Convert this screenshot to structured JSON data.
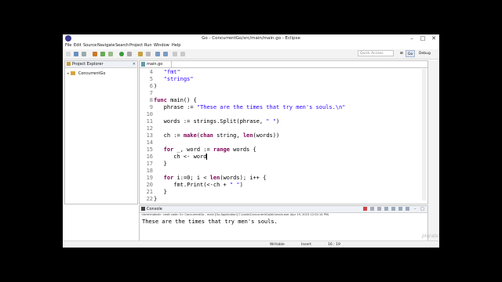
{
  "window": {
    "title": "Go - ConcurrentGo/src/main/main.go - Eclipse"
  },
  "menu": [
    "File",
    "Edit",
    "Source",
    "Navigate",
    "Search",
    "Project",
    "Run",
    "Window",
    "Help"
  ],
  "toolbar": {
    "quick_access_placeholder": "Quick Access",
    "perspectives": [
      "Go",
      "Debug"
    ]
  },
  "project_explorer": {
    "tab_label": "Project Explorer",
    "project": "ConcurrentGo"
  },
  "editor": {
    "tab_label": "main.go",
    "lines": [
      {
        "num": "4",
        "text": "\t\"fmt\""
      },
      {
        "num": "5",
        "text": "\t\"strings\""
      },
      {
        "num": "6",
        "text": ")"
      },
      {
        "num": "7",
        "text": ""
      },
      {
        "num": "8",
        "text": "func main() {"
      },
      {
        "num": "9",
        "text": "\tphrase := \"These are the times that try men's souls.\\n\""
      },
      {
        "num": "10",
        "text": ""
      },
      {
        "num": "11",
        "text": "\twords := strings.Split(phrase, \" \")"
      },
      {
        "num": "12",
        "text": ""
      },
      {
        "num": "13",
        "text": "\tch := make(chan string, len(words))"
      },
      {
        "num": "14",
        "text": ""
      },
      {
        "num": "15",
        "text": "\tfor _, word := range words {"
      },
      {
        "num": "16",
        "text": "\t\tch <- word"
      },
      {
        "num": "17",
        "text": "\t}"
      },
      {
        "num": "18",
        "text": ""
      },
      {
        "num": "19",
        "text": "\tfor i:=0; i < len(words); i++ {"
      },
      {
        "num": "20",
        "text": "\t\tfmt.Print(<-ch + \" \")"
      },
      {
        "num": "21",
        "text": "\t}"
      },
      {
        "num": "22",
        "text": "}"
      }
    ]
  },
  "console": {
    "tab_label": "Console",
    "terminated": "<terminated> <exit code: 0> ConcurrentGo - main [Go Application] C:\\code\\ConcurrentGo\\bin\\main.exe (Apr 19, 2015 12:02:14 PM)",
    "output": "These are the times that try men's souls."
  },
  "status": {
    "mode": "Writable",
    "insert": "Insert",
    "position": "16 : 19"
  },
  "watermark": "pluralsight"
}
